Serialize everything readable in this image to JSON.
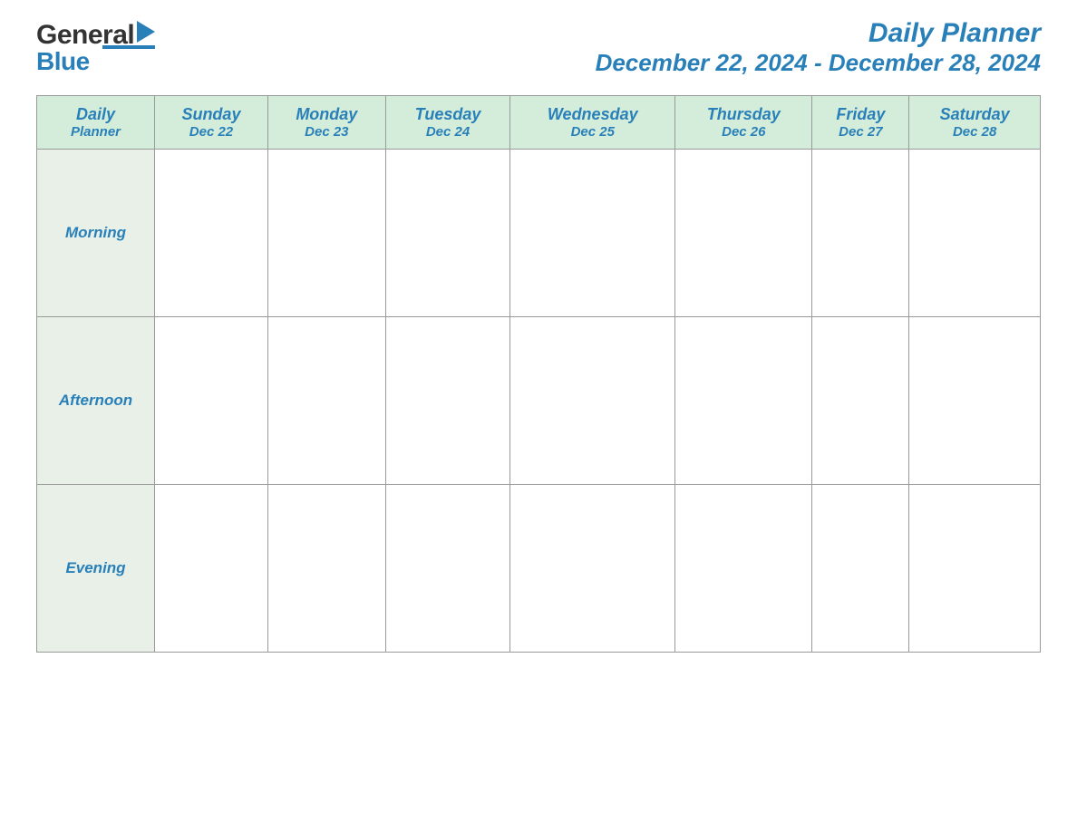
{
  "header": {
    "logo": {
      "general": "General",
      "blue": "Blue"
    },
    "title": "Daily Planner",
    "date_range": "December 22, 2024 - December 28, 2024"
  },
  "table": {
    "header_col": {
      "line1": "Daily",
      "line2": "Planner"
    },
    "days": [
      {
        "name": "Sunday",
        "date": "Dec 22"
      },
      {
        "name": "Monday",
        "date": "Dec 23"
      },
      {
        "name": "Tuesday",
        "date": "Dec 24"
      },
      {
        "name": "Wednesday",
        "date": "Dec 25"
      },
      {
        "name": "Thursday",
        "date": "Dec 26"
      },
      {
        "name": "Friday",
        "date": "Dec 27"
      },
      {
        "name": "Saturday",
        "date": "Dec 28"
      }
    ],
    "rows": [
      {
        "label": "Morning"
      },
      {
        "label": "Afternoon"
      },
      {
        "label": "Evening"
      }
    ]
  }
}
